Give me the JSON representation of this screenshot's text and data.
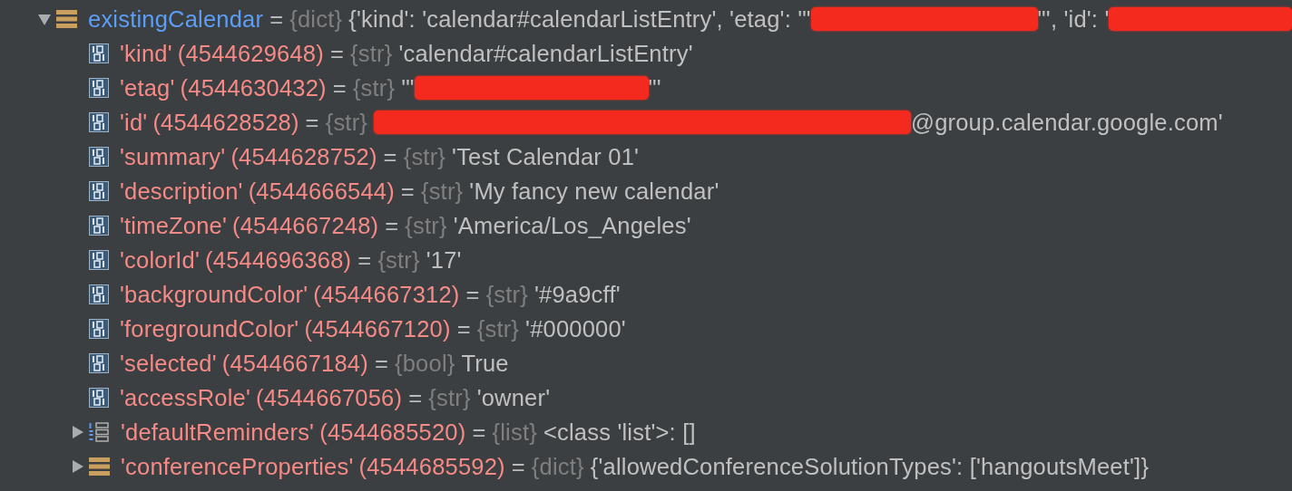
{
  "separator": "=",
  "variables": [
    {
      "name": "existingCalendar",
      "type": "{dict}",
      "kind": "dict",
      "expanded": true,
      "value_parts": [
        {
          "kind": "text",
          "text": "{'kind': 'calendar#calendarListEntry', 'etag': '\""
        },
        {
          "kind": "redacted"
        },
        {
          "kind": "text",
          "text": "\"', 'id': '"
        },
        {
          "kind": "redacted"
        }
      ],
      "children": [
        {
          "name": "'kind'",
          "address": "(4544629648)",
          "type": "{str}",
          "kind": "primitive",
          "value_parts": [
            {
              "kind": "text",
              "text": "'calendar#calendarListEntry'"
            }
          ]
        },
        {
          "name": "'etag'",
          "address": "(4544630432)",
          "type": "{str}",
          "kind": "primitive",
          "value_parts": [
            {
              "kind": "text",
              "text": "'\""
            },
            {
              "kind": "redacted"
            },
            {
              "kind": "text",
              "text": "\"'"
            }
          ]
        },
        {
          "name": "'id'",
          "address": "(4544628528)",
          "type": "{str}",
          "kind": "primitive",
          "value_parts": [
            {
              "kind": "redacted"
            },
            {
              "kind": "text",
              "text": "@group.calendar.google.com'"
            }
          ]
        },
        {
          "name": "'summary'",
          "address": "(4544628752)",
          "type": "{str}",
          "kind": "primitive",
          "value_parts": [
            {
              "kind": "text",
              "text": "'Test Calendar 01'"
            }
          ]
        },
        {
          "name": "'description'",
          "address": "(4544666544)",
          "type": "{str}",
          "kind": "primitive",
          "value_parts": [
            {
              "kind": "text",
              "text": "'My fancy new calendar'"
            }
          ]
        },
        {
          "name": "'timeZone'",
          "address": "(4544667248)",
          "type": "{str}",
          "kind": "primitive",
          "value_parts": [
            {
              "kind": "text",
              "text": "'America/Los_Angeles'"
            }
          ]
        },
        {
          "name": "'colorId'",
          "address": "(4544696368)",
          "type": "{str}",
          "kind": "primitive",
          "value_parts": [
            {
              "kind": "text",
              "text": "'17'"
            }
          ]
        },
        {
          "name": "'backgroundColor'",
          "address": "(4544667312)",
          "type": "{str}",
          "kind": "primitive",
          "value_parts": [
            {
              "kind": "text",
              "text": "'#9a9cff'"
            }
          ]
        },
        {
          "name": "'foregroundColor'",
          "address": "(4544667120)",
          "type": "{str}",
          "kind": "primitive",
          "value_parts": [
            {
              "kind": "text",
              "text": "'#000000'"
            }
          ]
        },
        {
          "name": "'selected'",
          "address": "(4544667184)",
          "type": "{bool}",
          "kind": "primitive",
          "value_parts": [
            {
              "kind": "text",
              "text": "True"
            }
          ]
        },
        {
          "name": "'accessRole'",
          "address": "(4544667056)",
          "type": "{str}",
          "kind": "primitive",
          "value_parts": [
            {
              "kind": "text",
              "text": "'owner'"
            }
          ]
        },
        {
          "name": "'defaultReminders'",
          "address": "(4544685520)",
          "type": "{list}",
          "kind": "list",
          "expanded": false,
          "value_parts": [
            {
              "kind": "text",
              "text": "<class 'list'>: []"
            }
          ]
        },
        {
          "name": "'conferenceProperties'",
          "address": "(4544685592)",
          "type": "{dict}",
          "kind": "dict",
          "expanded": false,
          "value_parts": [
            {
              "kind": "text",
              "text": "{'allowedConferenceSolutionTypes': ['hangoutsMeet']}"
            }
          ]
        }
      ]
    }
  ]
}
